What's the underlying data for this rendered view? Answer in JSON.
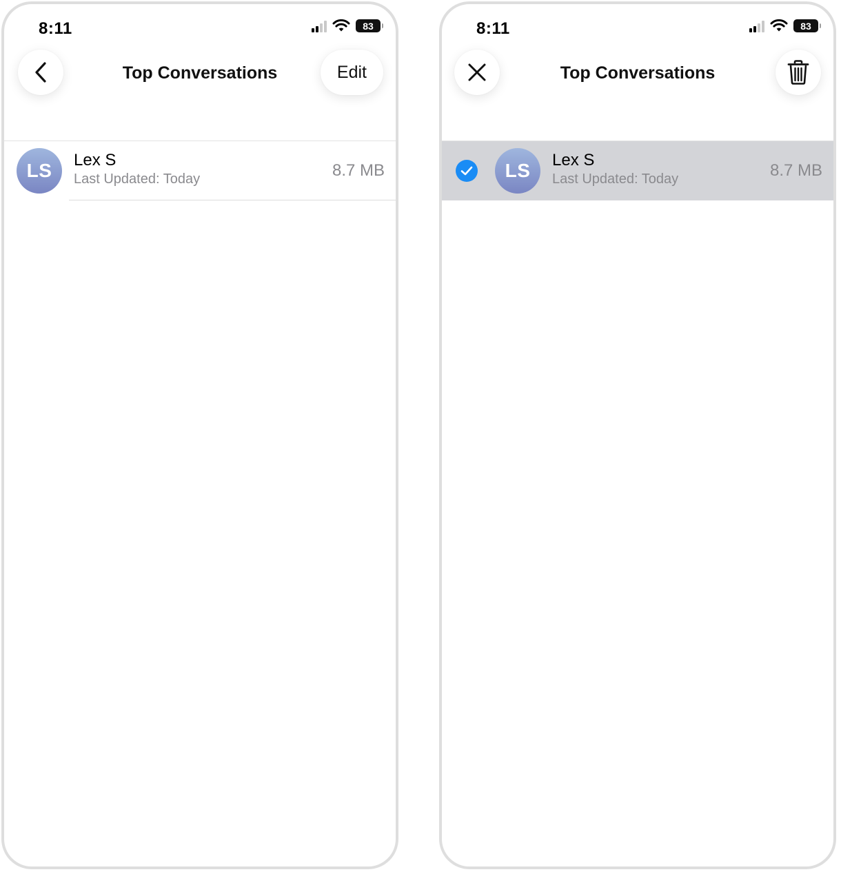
{
  "screens": [
    {
      "status": {
        "time": "8:11",
        "battery": "83"
      },
      "nav": {
        "title": "Top Conversations",
        "left_icon": "chevron-left-icon",
        "right_label": "Edit"
      },
      "conversation": {
        "initials": "LS",
        "name": "Lex S",
        "subtitle": "Last Updated: Today",
        "size": "8.7 MB",
        "selected": false
      }
    },
    {
      "status": {
        "time": "8:11",
        "battery": "83"
      },
      "nav": {
        "title": "Top Conversations",
        "left_icon": "close-icon",
        "right_icon": "trash-icon"
      },
      "conversation": {
        "initials": "LS",
        "name": "Lex S",
        "subtitle": "Last Updated: Today",
        "size": "8.7 MB",
        "selected": true
      }
    }
  ],
  "colors": {
    "accent": "#1a8cf5",
    "selected_row": "#d3d4d8",
    "secondary_text": "#8a8a8e",
    "avatar_gradient_top": "#9fb6de",
    "avatar_gradient_bottom": "#7a86c3"
  }
}
